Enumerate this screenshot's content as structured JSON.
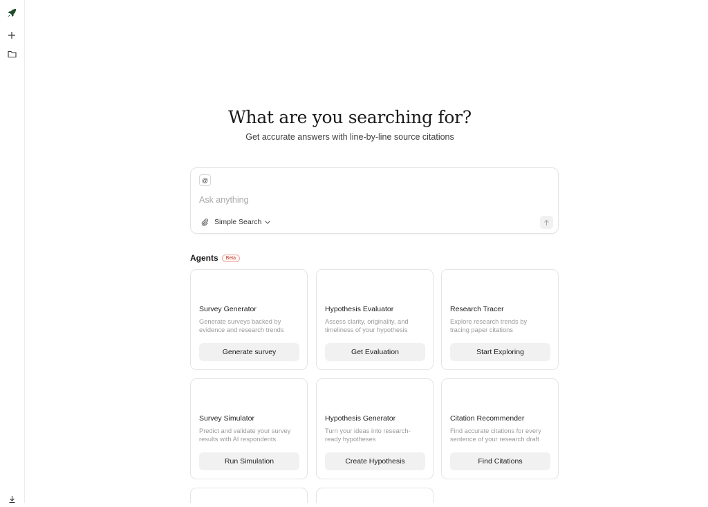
{
  "sidebar": {
    "logo_icon": "rocket-icon",
    "new_icon": "plus-icon",
    "folder_icon": "folder-icon",
    "download_icon": "download-icon"
  },
  "hero": {
    "title": "What are you searching for?",
    "subtitle": "Get accurate answers with line-by-line source citations"
  },
  "search": {
    "mention_label": "@",
    "placeholder": "Ask anything",
    "mode": "Simple Search"
  },
  "agents": {
    "title": "Agents",
    "badge": "Beta",
    "cards": [
      {
        "title": "Survey Generator",
        "desc": "Generate surveys backed by evidence and research trends",
        "button": "Generate survey"
      },
      {
        "title": "Hypothesis Evaluator",
        "desc": "Assess clarity, originality, and timeliness of your hypothesis",
        "button": "Get Evaluation"
      },
      {
        "title": "Research Tracer",
        "desc": "Explore research trends by tracing paper citations",
        "button": "Start Exploring"
      },
      {
        "title": "Survey Simulator",
        "desc": "Predict and validate your survey results with AI respondents",
        "button": "Run Simulation"
      },
      {
        "title": "Hypothesis Generator",
        "desc": "Turn your ideas into research-ready hypotheses",
        "button": "Create Hypothesis"
      },
      {
        "title": "Citation Recommender",
        "desc": "Find accurate citations for every sentence of your research draft",
        "button": "Find Citations"
      }
    ]
  },
  "colors": {
    "logo": "#1f4d2b",
    "badge": "#c0392b"
  }
}
